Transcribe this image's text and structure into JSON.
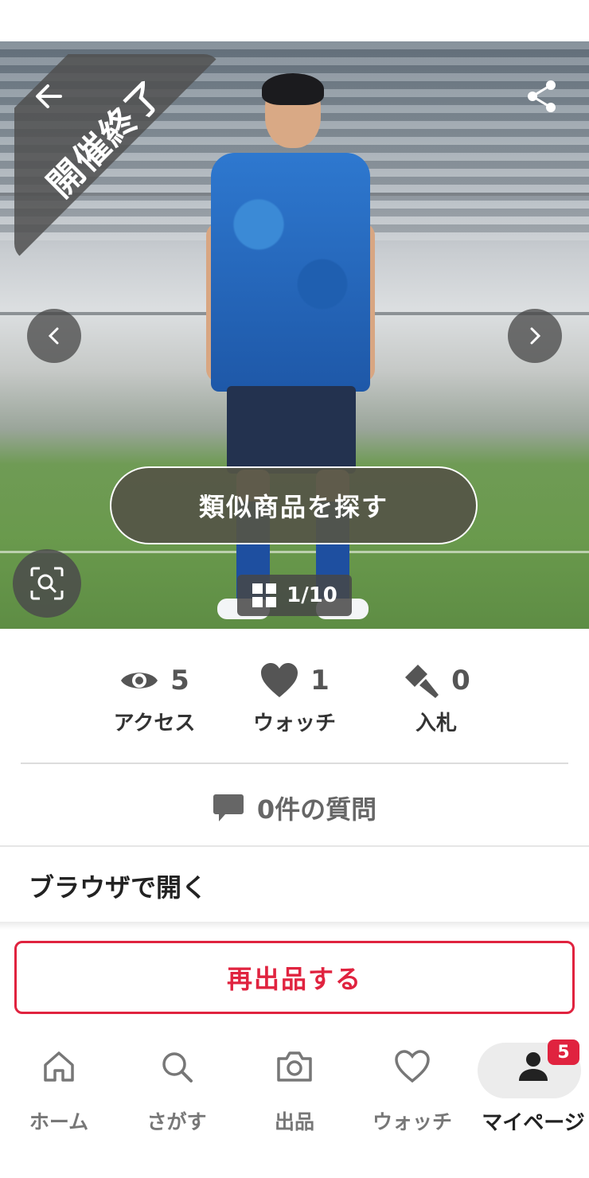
{
  "hero": {
    "ended_label": "開催終了",
    "similar_button": "類似商品を探す",
    "image_counter": "1/10"
  },
  "stats": [
    {
      "icon": "eye-icon",
      "value": "5",
      "label": "アクセス"
    },
    {
      "icon": "heart-icon",
      "value": "1",
      "label": "ウォッチ"
    },
    {
      "icon": "gavel-icon",
      "value": "0",
      "label": "入札"
    }
  ],
  "questions": {
    "label": "0件の質問"
  },
  "browser": {
    "label": "ブラウザで開く"
  },
  "relist": {
    "label": "再出品する"
  },
  "bottom_nav": {
    "items": [
      {
        "icon": "home-icon",
        "label": "ホーム"
      },
      {
        "icon": "search-icon",
        "label": "さがす"
      },
      {
        "icon": "camera-icon",
        "label": "出品"
      },
      {
        "icon": "heart-icon",
        "label": "ウォッチ"
      },
      {
        "icon": "person-icon",
        "label": "マイページ",
        "badge": "5",
        "active": true
      }
    ]
  },
  "colors": {
    "accent": "#e0233f",
    "text_gray": "#666666"
  }
}
